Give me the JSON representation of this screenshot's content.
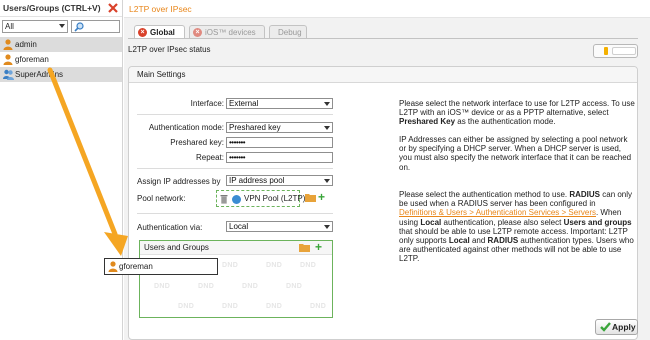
{
  "left_panel": {
    "title": "Users/Groups (CTRL+V)",
    "filter_value": "All",
    "items": [
      {
        "label": "admin"
      },
      {
        "label": "gforeman"
      },
      {
        "label": "SuperAdmins"
      }
    ]
  },
  "right_panel": {
    "title": "L2TP over IPsec",
    "tabs": [
      {
        "label": "Global"
      },
      {
        "label": "iOS™ devices"
      },
      {
        "label": "Debug"
      }
    ],
    "status_label": "L2TP over IPsec status",
    "main_settings": {
      "header": "Main Settings",
      "interface_label": "Interface:",
      "interface_value": "External",
      "auth_mode_label": "Authentication mode:",
      "auth_mode_value": "Preshared key",
      "preshared_label": "Preshared key:",
      "preshared_value": "•••••••",
      "repeat_label": "Repeat:",
      "repeat_value": "•••••••",
      "assign_label": "Assign IP addresses by",
      "assign_value": "IP address pool",
      "pool_label": "Pool network:",
      "pool_value": "VPN Pool (L2TP)",
      "auth_via_label": "Authentication via:",
      "auth_via_value": "Local",
      "users_groups_header": "Users and Groups",
      "dnd_text": "DND"
    },
    "help": {
      "p1": "Please select the network interface to use for L2TP access. To use L2TP with an iOS™ device or as a PPTP alternative, select ",
      "p1_bold": "Preshared Key",
      "p1_end": " as the authentication mode.",
      "p2": "IP Addresses can either be assigned by selecting a pool network or by specifying a DHCP server. When a DHCP server is used, you must also specify the network interface that it can be reached on.",
      "p3a": "Please select the authentication method to use. ",
      "p3_radius": "RADIUS",
      "p3b": " can only be used when a RADIUS server has been configured in ",
      "p3_link": "Definitions & Users > Authentication Services > Servers",
      "p3c": ". When using ",
      "p3_local": "Local",
      "p3d": " authentication, please also select ",
      "p3_ug": "Users and groups",
      "p3e": " that should be able to use L2TP remote access. Important: L2TP only supports ",
      "p3_local2": "Local",
      "p3f": " and ",
      "p3_radius2": "RADIUS",
      "p3g": " authentication types. Users who are authenticated against other methods will not be able to use L2TP."
    },
    "apply_label": "Apply"
  },
  "drag": {
    "label": "gforeman"
  },
  "colors": {
    "accent_orange": "#e8861a",
    "close_red": "#d9412a",
    "toggle_yellow": "#f4b000",
    "drop_green": "#6cb35c",
    "user_icon": "#e08a1e"
  },
  "icons": [
    "close-icon",
    "search-icon",
    "user-icon",
    "group-icon",
    "trash-icon",
    "network-icon",
    "folder-icon",
    "plus-icon",
    "checkmark-icon",
    "drag-arrow-icon"
  ]
}
